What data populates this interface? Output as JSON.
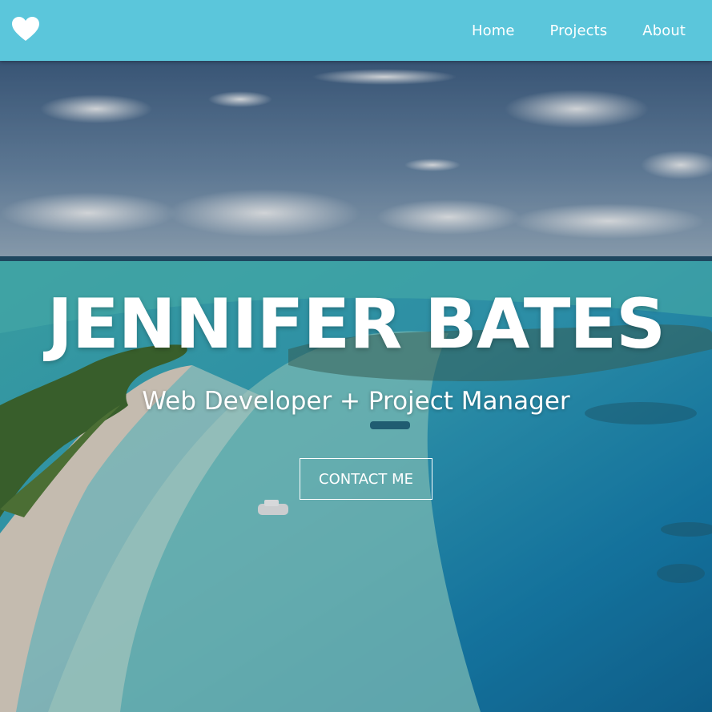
{
  "nav": {
    "logo_icon": "heart-icon",
    "links": [
      {
        "label": "Home"
      },
      {
        "label": "Projects"
      },
      {
        "label": "About"
      }
    ],
    "background": "#5bc6db"
  },
  "hero": {
    "title": "JENNIFER BATES",
    "subtitle": "Web Developer + Project Manager",
    "cta_label": "CONTACT ME",
    "background_image": "aerial tropical beach and turquoise lagoon"
  }
}
